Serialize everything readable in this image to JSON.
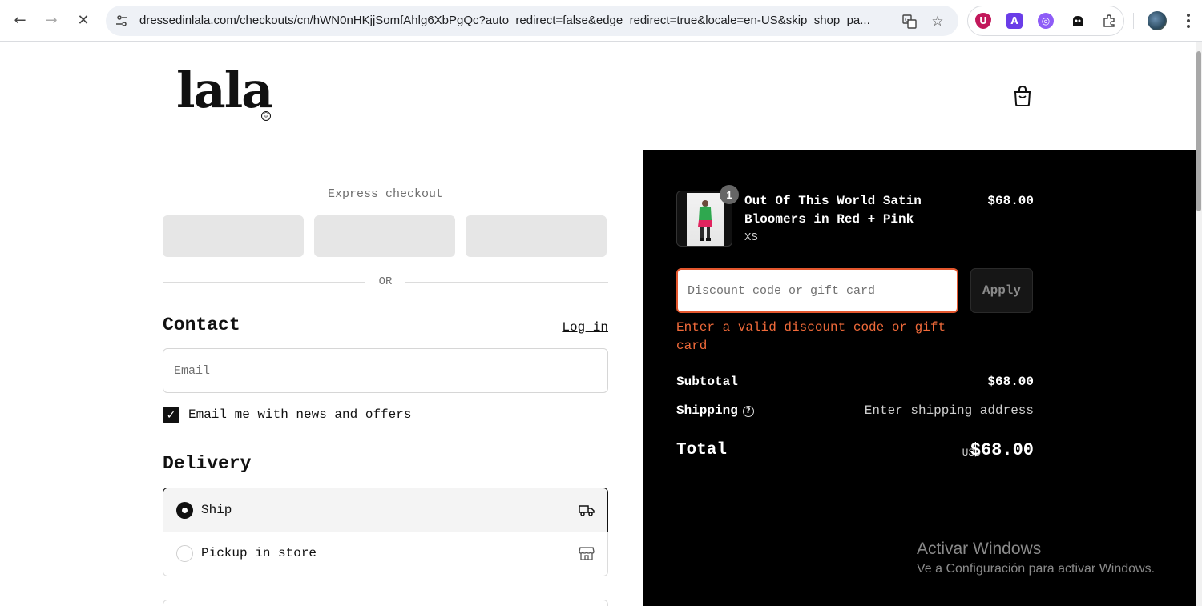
{
  "browser": {
    "url": "dressedinlala.com/checkouts/cn/hWN0nHKjjSomfAhlg6XbPgQc?auto_redirect=false&edge_redirect=true&locale=en-US&skip_shop_pa...",
    "extensions": [
      "ublock-icon",
      "a-icon",
      "swirl-icon",
      "ghost-icon",
      "puzzle-icon"
    ]
  },
  "header": {
    "logo_text": "lala",
    "logo_smile": "☺"
  },
  "express": {
    "title": "Express checkout",
    "or_text": "OR"
  },
  "contact": {
    "title": "Contact",
    "login_label": "Log in",
    "email_placeholder": "Email",
    "newsletter_label": "Email me with news and offers",
    "newsletter_checked": true
  },
  "delivery": {
    "title": "Delivery",
    "options": [
      {
        "label": "Ship",
        "selected": true,
        "icon": "truck-icon"
      },
      {
        "label": "Pickup in store",
        "selected": false,
        "icon": "store-icon"
      }
    ]
  },
  "order": {
    "item": {
      "quantity": "1",
      "name": "Out Of This World Satin Bloomers in Red + Pink",
      "variant": "XS",
      "price": "$68.00"
    },
    "discount_placeholder": "Discount code or gift card",
    "apply_label": "Apply",
    "discount_error": "Enter a valid discount code or gift card",
    "subtotal_label": "Subtotal",
    "subtotal_value": "$68.00",
    "shipping_label": "Shipping",
    "shipping_value": "Enter shipping address",
    "total_label": "Total",
    "total_currency": "USD",
    "total_value": "$68.00"
  },
  "watermark": {
    "title": "Activar Windows",
    "subtitle": "Ve a Configuración para activar Windows."
  },
  "colors": {
    "accent_error": "#f06a3a",
    "summary_bg": "#000000",
    "express_button": "#e6e6e6"
  }
}
